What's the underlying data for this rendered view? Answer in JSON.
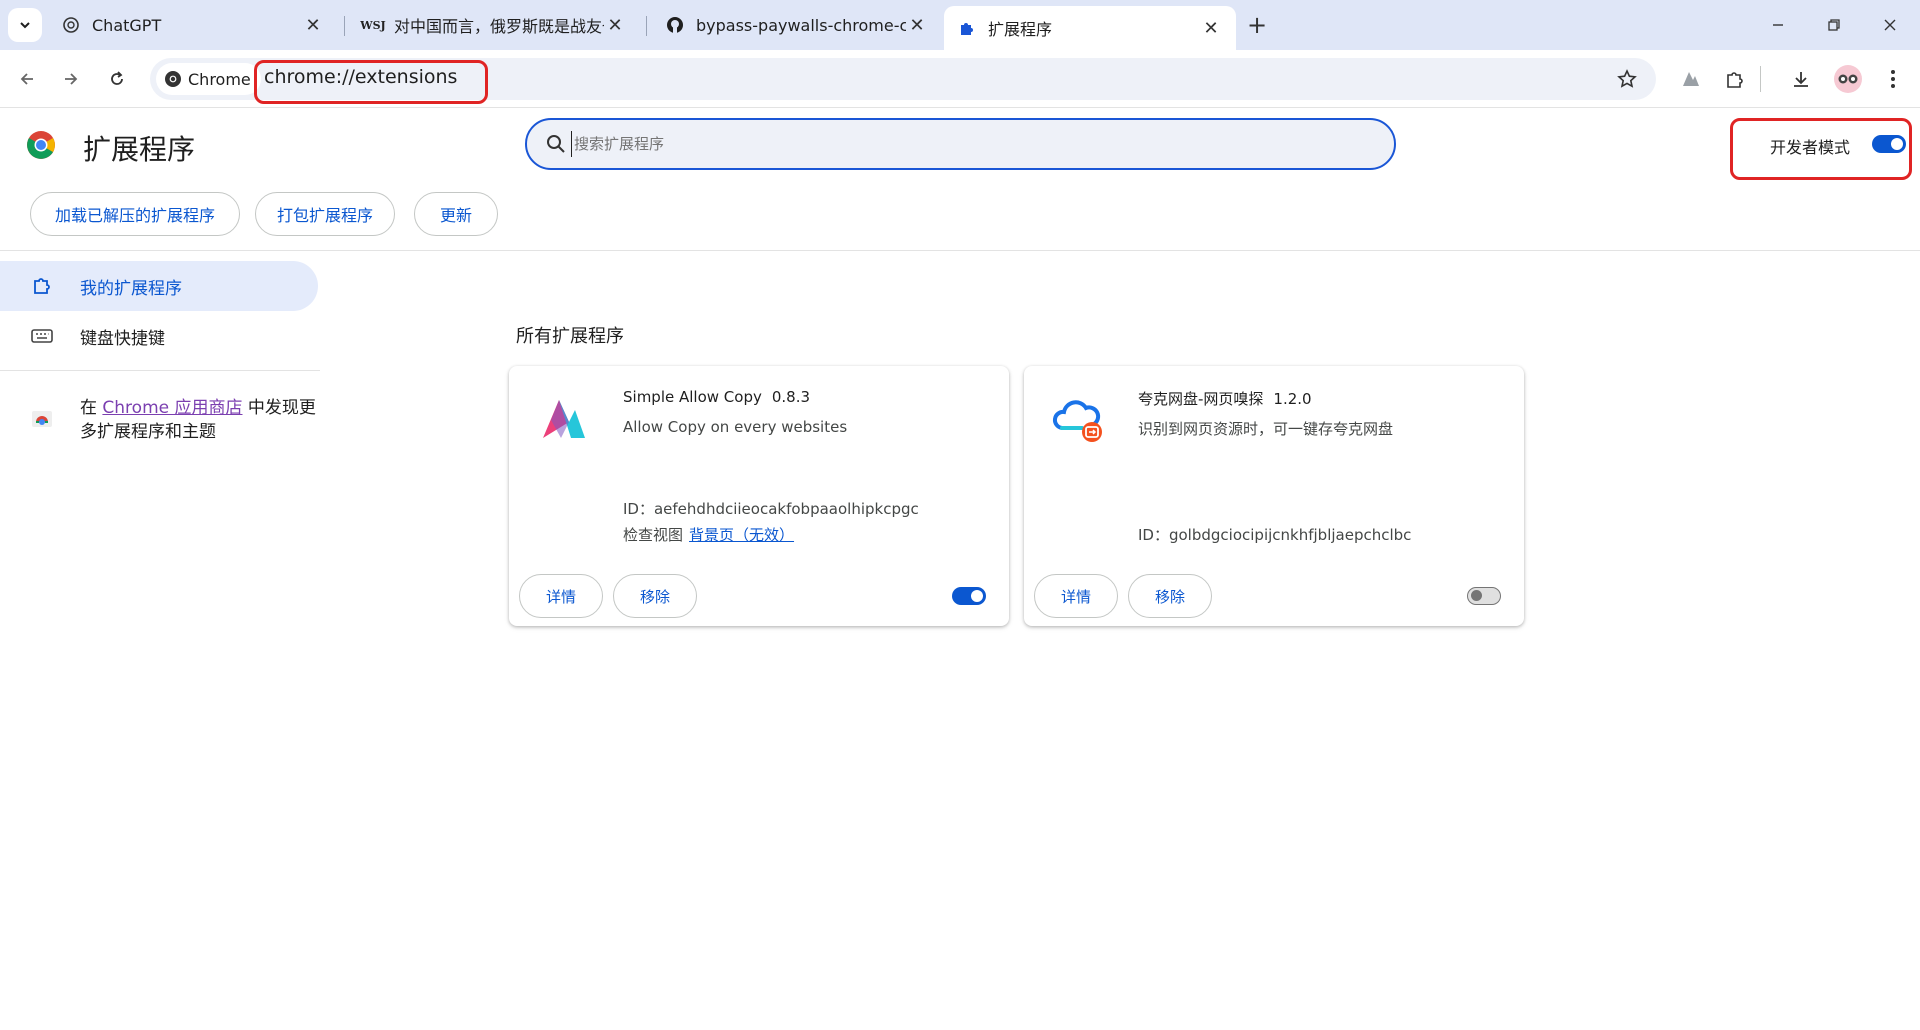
{
  "browser": {
    "tabs": [
      {
        "title": "ChatGPT",
        "favicon": "chatgpt-icon"
      },
      {
        "title": "对中国而言，俄罗斯既是战友也",
        "favicon": "wsj-icon"
      },
      {
        "title": "bypass-paywalls-chrome-clea",
        "favicon": "github-icon"
      },
      {
        "title": "扩展程序",
        "favicon": "puzzle-icon"
      }
    ],
    "wsj_favicon_text": "WSJ",
    "active_tab": 3,
    "omnibox": {
      "chip_label": "Chrome",
      "url": "chrome://extensions"
    }
  },
  "page": {
    "title": "扩展程序",
    "search_placeholder": "搜索扩展程序",
    "dev_mode_label": "开发者模式",
    "dev_mode_on": true,
    "actions": {
      "load_unpacked": "加载已解压的扩展程序",
      "pack": "打包扩展程序",
      "update": "更新"
    }
  },
  "sidebar": {
    "items": [
      {
        "label": "我的扩展程序",
        "icon": "extension-outline-icon",
        "active": true
      },
      {
        "label": "键盘快捷键",
        "icon": "keyboard-icon",
        "active": false
      }
    ],
    "store": {
      "prefix": "在",
      "link": "Chrome 应用商店",
      "suffix": "中发现更多扩展程序和主题"
    }
  },
  "content": {
    "section_title": "所有扩展程序",
    "extensions": [
      {
        "name": "Simple Allow Copy",
        "version": "0.8.3",
        "description": "Allow Copy on every websites",
        "id_label": "ID：",
        "id": "aefehdhdciieocakfobpaaolhipkcpgc",
        "inspect_label": "检查视图",
        "inspect_link": "背景页（无效）",
        "details_label": "详情",
        "remove_label": "移除",
        "enabled": true,
        "icon": "allow-copy-logo-icon"
      },
      {
        "name": "夸克网盘-网页嗅探",
        "version": "1.2.0",
        "description": "识别到网页资源时，可一键存夸克网盘",
        "id_label": "ID：",
        "id": "golbdgciocipijcnkhfjbljaepchclbc",
        "details_label": "详情",
        "remove_label": "移除",
        "enabled": false,
        "icon": "quark-cloud-icon"
      }
    ]
  },
  "colors": {
    "accent": "#0b57d0",
    "highlight": "#e02424",
    "tabstrip": "#dfe6f7"
  }
}
